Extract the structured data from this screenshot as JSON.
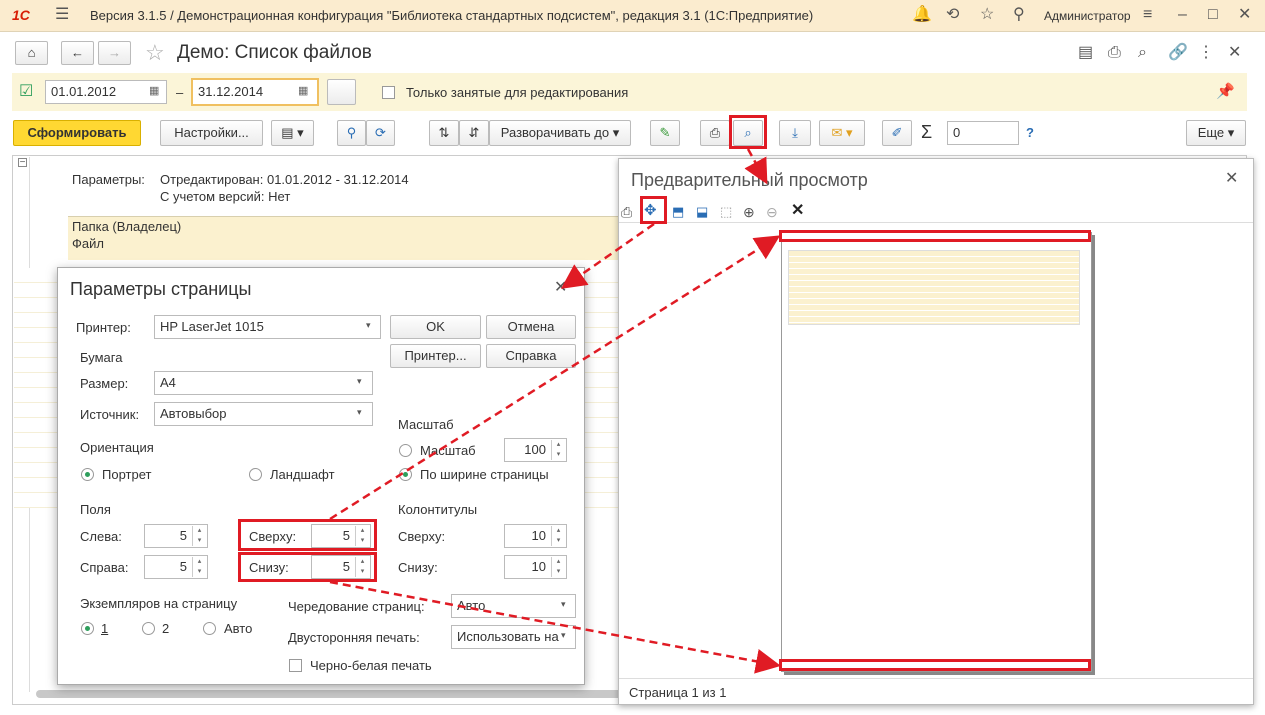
{
  "app": {
    "logo": "1С",
    "title": "Версия 3.1.5 / Демонстрационная конфигурация \"Библиотека стандартных подсистем\", редакция 3.1  (1С:Предприятие)",
    "user": "Администратор"
  },
  "form": {
    "title": "Демо: Список файлов",
    "date_from": "01.01.2012",
    "date_sep": "–",
    "date_to": "31.12.2014",
    "only_editing_label": "Только занятые для редактирования"
  },
  "toolbar": {
    "generate": "Сформировать",
    "settings": "Настройки...",
    "expand_to": "Разворачивать до",
    "sum_value": "0",
    "help": "?",
    "more": "Еще"
  },
  "report": {
    "params_label": "Параметры:",
    "params_value": "Отредактирован: 01.01.2012 - 31.12.2014",
    "versions": "С учетом версий: Нет",
    "col_folder": "Папка (Владелец)",
    "col_file": "Файл"
  },
  "page_params": {
    "title": "Параметры страницы",
    "printer_label": "Принтер:",
    "printer_value": "HP LaserJet 1015",
    "ok": "OK",
    "cancel": "Отмена",
    "printer_btn": "Принтер...",
    "help_btn": "Справка",
    "paper": "Бумага",
    "size_label": "Размер:",
    "size_value": "A4",
    "source_label": "Источник:",
    "source_value": "Автовыбор",
    "scale_group": "Масштаб",
    "scale_label": "Масштаб",
    "scale_value": "100",
    "fit_width": "По ширине страницы",
    "orientation": "Ориентация",
    "portrait": "Портрет",
    "landscape": "Ландшафт",
    "margins": "Поля",
    "left_label": "Слева:",
    "left_value": "5",
    "right_label": "Справа:",
    "right_value": "5",
    "top_label": "Сверху:",
    "top_value": "5",
    "bottom_label": "Снизу:",
    "bottom_value": "5",
    "headers": "Колонтитулы",
    "h_top_label": "Сверху:",
    "h_top_value": "10",
    "h_bottom_label": "Снизу:",
    "h_bottom_value": "10",
    "copies": "Экземпляров на страницу",
    "c1": "1",
    "c2": "2",
    "cauto": "Авто",
    "collate_label": "Чередование страниц:",
    "collate_value": "Авто",
    "duplex_label": "Двусторонняя печать:",
    "duplex_value": "Использовать на",
    "bw_label": "Черно-белая печать"
  },
  "preview": {
    "title": "Предварительный просмотр",
    "status": "Страница 1 из 1"
  }
}
